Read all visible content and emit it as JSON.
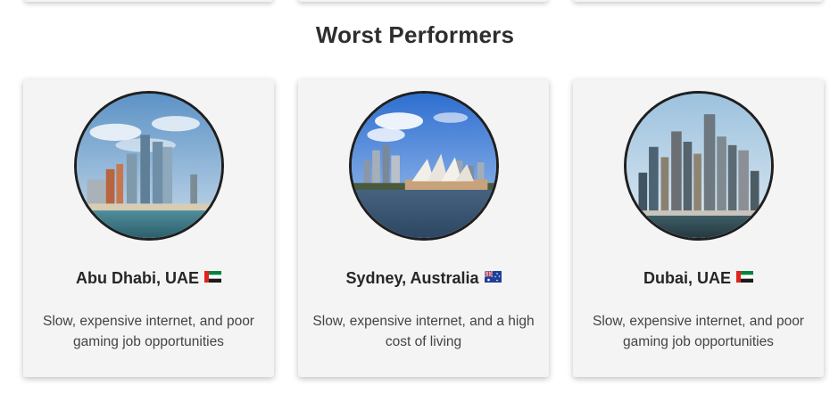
{
  "section": {
    "title": "Worst Performers"
  },
  "cards": [
    {
      "city": "Abu Dhabi, UAE",
      "flag_icon": "uae-flag-icon",
      "description": "Slow, expensive internet, and poor gaming job opportunities",
      "photo": "abu-dhabi-skyline"
    },
    {
      "city": "Sydney, Australia",
      "flag_icon": "australia-flag-icon",
      "description": "Slow, expensive internet, and a high cost of living",
      "photo": "sydney-opera-house"
    },
    {
      "city": "Dubai, UAE",
      "flag_icon": "uae-flag-icon",
      "description": "Slow, expensive internet, and poor gaming job opportunities",
      "photo": "dubai-marina-skyline"
    }
  ],
  "colors": {
    "card_background": "#f4f4f4",
    "title_text": "#2e2e2e",
    "body_text": "#444444",
    "photo_border": "#1f1f1f"
  }
}
